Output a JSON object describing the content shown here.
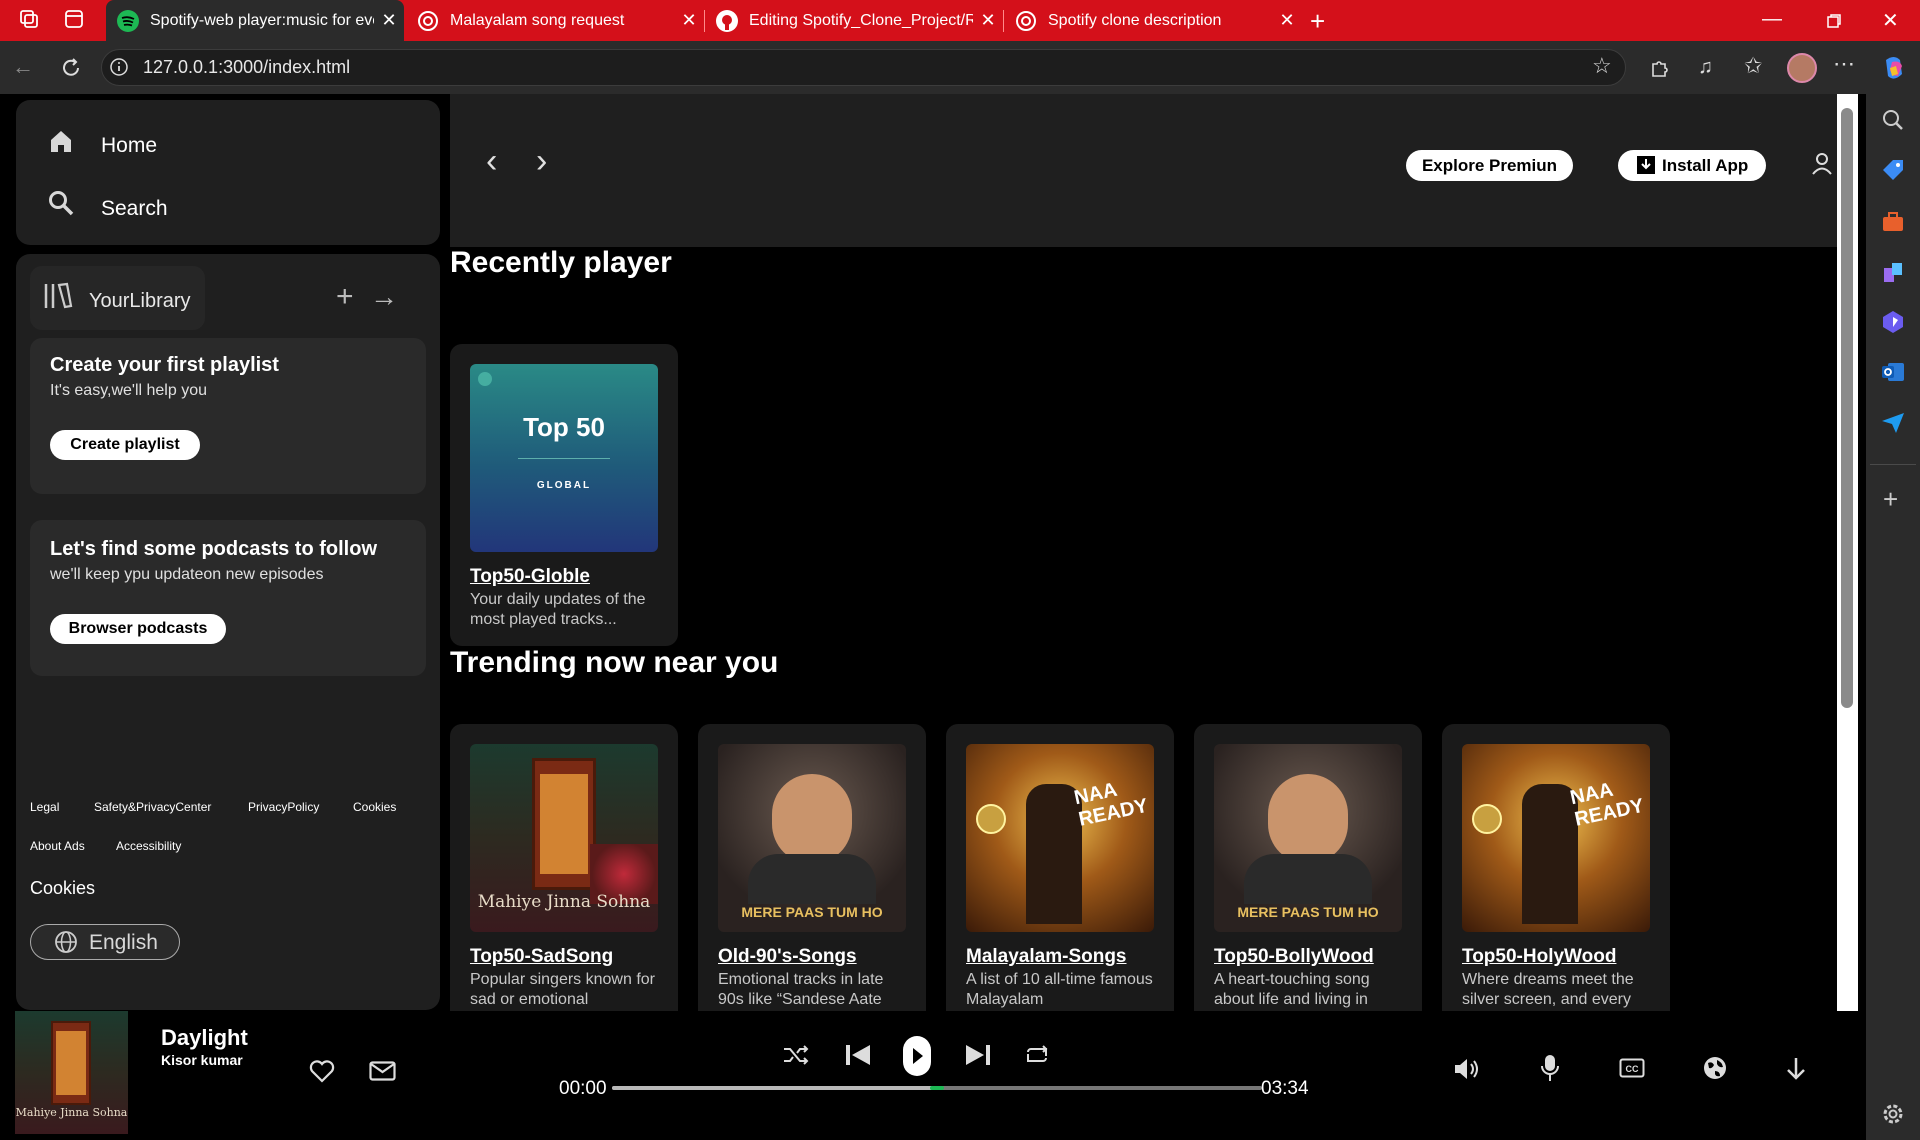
{
  "browser": {
    "tabs": [
      {
        "label": "Spotify-web player:music for ever"
      },
      {
        "label": "Malayalam song request"
      },
      {
        "label": "Editing Spotify_Clone_Project/RE/"
      },
      {
        "label": "Spotify clone description"
      }
    ],
    "url": "127.0.0.1:3000/index.html"
  },
  "nav": {
    "home": "Home",
    "search": "Search"
  },
  "library": {
    "label": "YourLibrary",
    "playlist_card": {
      "title": "Create your first playlist",
      "subtitle": "It's easy,we'll help you",
      "button": "Create playlist"
    },
    "podcast_card": {
      "title": "Let's find some podcasts to follow",
      "subtitle": "we'll keep ypu updateon new episodes",
      "button": "Browser podcasts"
    },
    "footer_links": [
      "Legal",
      "Safety&PrivacyCenter",
      "PrivacyPolicy",
      "Cookies",
      "About Ads",
      "Accessibility"
    ],
    "cookies": "Cookies",
    "language": "English"
  },
  "header": {
    "explore_premium": "Explore Premiun",
    "install_app": "Install App"
  },
  "recently": {
    "title": "Recently player",
    "cards": [
      {
        "title": "Top50-Globle",
        "desc": "Your daily updates of the most played tracks...",
        "art_text": "Top 50",
        "art_sub": "GLOBAL"
      }
    ]
  },
  "trending": {
    "title": "Trending now near you",
    "cards": [
      {
        "title": "Top50-SadSong",
        "desc": "Popular singers known for sad or emotional",
        "art_text": "Mahiye Jinna Sohna"
      },
      {
        "title": "Old-90's-Songs",
        "desc": "Emotional tracks in late 90s like “Sandese Aate",
        "art_text": "MERE PAAS TUM HO"
      },
      {
        "title": "Malayalam-Songs",
        "desc": "A list of 10 all-time famous Malayalam",
        "art_text": "NAA READY"
      },
      {
        "title": "Top50-BollyWood",
        "desc": "A heart-touching song about life and living in",
        "art_text": "MERE PAAS TUM HO"
      },
      {
        "title": "Top50-HolyWood",
        "desc": "Where dreams meet the silver screen, and every",
        "art_text": "NAA READY"
      }
    ]
  },
  "player": {
    "song": "Daylight",
    "artist": "Kisor kumar",
    "cover_text": "Mahiye Jinna Sohna",
    "current_time": "00:00",
    "total_time": "03:34",
    "progress": 0.5
  },
  "colors": {
    "accent": "#1db954",
    "tabbar": "#d4101a"
  }
}
